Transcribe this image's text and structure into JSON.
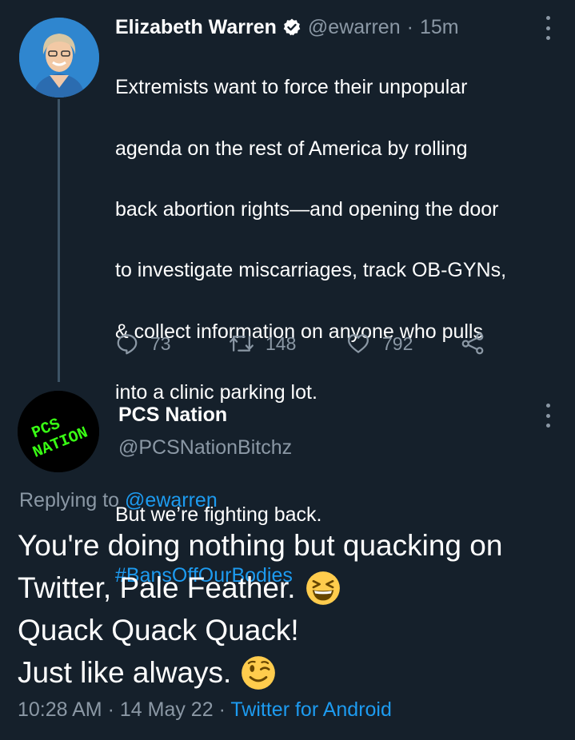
{
  "tweet1": {
    "author_name": "Elizabeth Warren",
    "handle": "@ewarren",
    "separator": "·",
    "time_ago": "15m",
    "text_lines": [
      "Extremists want to force their unpopular",
      "agenda on the rest of America by rolling",
      "back abortion rights—and opening the door",
      "to investigate miscarriages, track OB-GYNs,",
      "& collect information on anyone who pulls",
      "into a clinic parking lot.",
      "",
      "But we’re fighting back."
    ],
    "hashtag": "#BansOffOurBodies",
    "replies": "73",
    "retweets": "148",
    "likes": "792"
  },
  "tweet2": {
    "author_name": "PCS Nation",
    "handle": "@PCSNationBitchz",
    "avatar_text": [
      "PCS",
      "NATION"
    ],
    "replying_prefix": "Replying to",
    "replying_to": "@ewarren",
    "text_lines": [
      "You're doing nothing but quacking on",
      "Twitter, Pale Feather.",
      "Quack Quack Quack!",
      "Just like always."
    ],
    "emojis": [
      "grinning-squinting-face",
      "winking-face"
    ],
    "time": "10:28 AM",
    "dot1": "·",
    "date": "14 May 22",
    "dot2": "·",
    "source": "Twitter for Android"
  },
  "colors": {
    "background": "#15202b",
    "text": "#ffffff",
    "secondary": "#8b98a5",
    "accent": "#1d9bf0",
    "thread_line": "#3d5466",
    "avatar_logo": "#39ff14"
  },
  "icons": {
    "reply": "reply-icon",
    "retweet": "retweet-icon",
    "like": "heart-icon",
    "share": "share-icon",
    "verified": "verified-badge-icon",
    "more": "more-icon"
  }
}
